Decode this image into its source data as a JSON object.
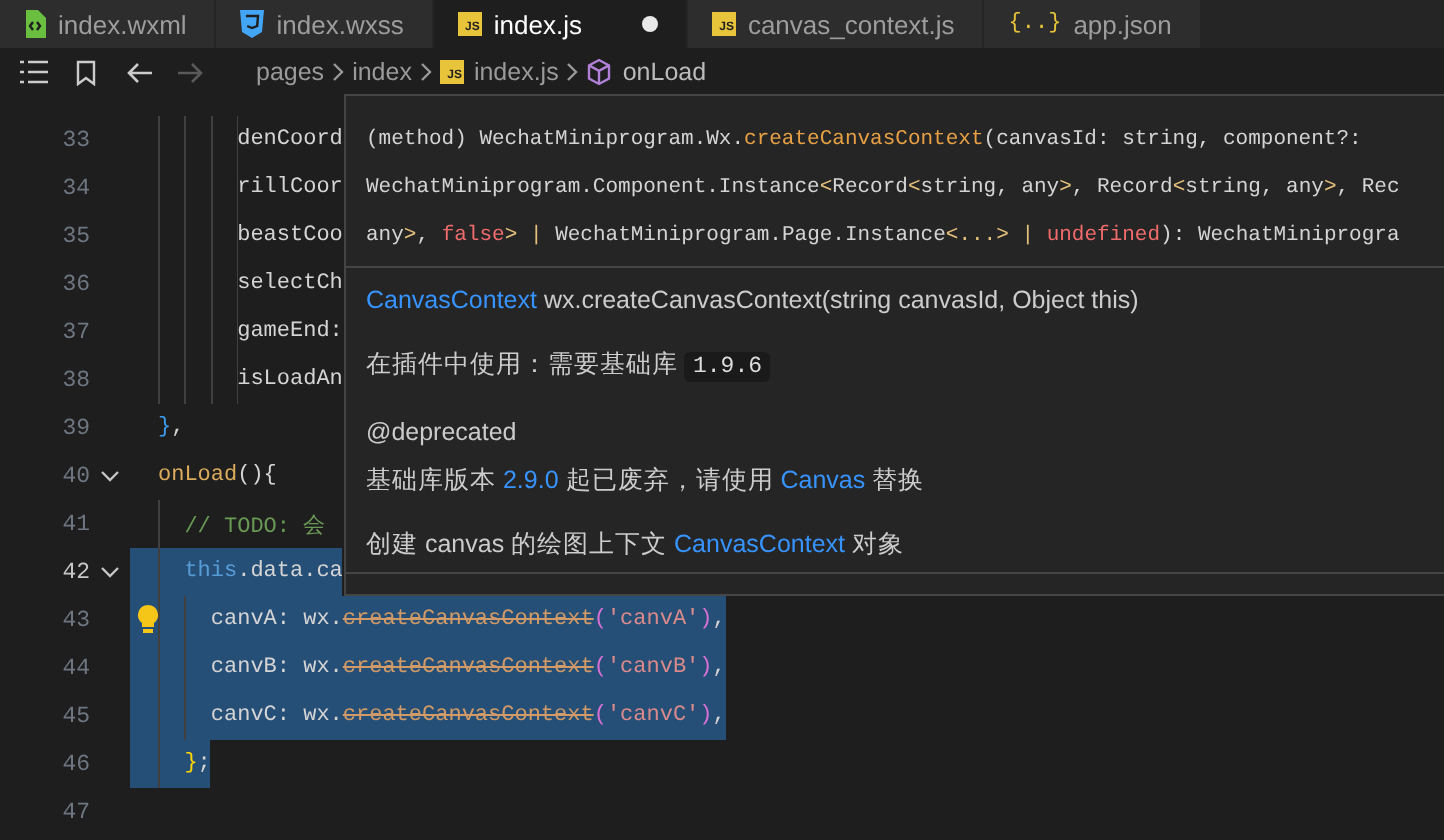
{
  "tabs": [
    {
      "label": "index.wxml",
      "kind": "wxml",
      "selected": false,
      "modified": false
    },
    {
      "label": "index.wxss",
      "kind": "wxss",
      "selected": false,
      "modified": false
    },
    {
      "label": "index.js",
      "kind": "js",
      "icon_label": "JS",
      "selected": true,
      "modified": true
    },
    {
      "label": "canvas_context.js",
      "kind": "js",
      "icon_label": "JS",
      "selected": false,
      "modified": false
    },
    {
      "label": "app.json",
      "kind": "json",
      "icon_label": "{..}",
      "selected": false,
      "modified": false
    }
  ],
  "breadcrumb": [
    {
      "label": "pages",
      "kind": "folder"
    },
    {
      "label": "index",
      "kind": "folder"
    },
    {
      "label": "index.js",
      "kind": "js",
      "icon_label": "JS"
    },
    {
      "label": "onLoad",
      "kind": "method"
    }
  ],
  "code_lines": [
    {
      "number": "33",
      "fold": false,
      "current": false,
      "selected": false,
      "bulb": false,
      "segments": [
        {
          "kind": "prop",
          "t": "      denCoord"
        }
      ]
    },
    {
      "number": "34",
      "fold": false,
      "current": false,
      "selected": false,
      "bulb": false,
      "segments": [
        {
          "kind": "prop",
          "t": "      rillCoor"
        }
      ]
    },
    {
      "number": "35",
      "fold": false,
      "current": false,
      "selected": false,
      "bulb": false,
      "segments": [
        {
          "kind": "prop",
          "t": "      beastCoo"
        }
      ]
    },
    {
      "number": "36",
      "fold": false,
      "current": false,
      "selected": false,
      "bulb": false,
      "segments": [
        {
          "kind": "prop",
          "t": "      selectCh"
        }
      ]
    },
    {
      "number": "37",
      "fold": false,
      "current": false,
      "selected": false,
      "bulb": false,
      "segments": [
        {
          "kind": "prop",
          "t": "      gameEnd:"
        }
      ]
    },
    {
      "number": "38",
      "fold": false,
      "current": false,
      "selected": false,
      "bulb": false,
      "segments": [
        {
          "kind": "prop",
          "t": "      isLoadAn"
        }
      ]
    },
    {
      "number": "39",
      "fold": false,
      "current": false,
      "selected": false,
      "bulb": false,
      "segments": [
        {
          "kind": "brace_blue",
          "t": "}"
        },
        {
          "kind": "plain",
          "t": ","
        }
      ]
    },
    {
      "number": "40",
      "fold": true,
      "current": false,
      "selected": false,
      "bulb": false,
      "segments": [
        {
          "kind": "method",
          "t": "onLoad"
        },
        {
          "kind": "plain",
          "t": "(){"
        }
      ]
    },
    {
      "number": "41",
      "fold": false,
      "current": false,
      "selected": false,
      "bulb": false,
      "segments": [
        {
          "kind": "comment",
          "t": "  // TODO: 会"
        }
      ]
    },
    {
      "number": "42",
      "fold": true,
      "current": true,
      "selected": true,
      "bulb": false,
      "segments": [
        {
          "kind": "keyword",
          "t": "  this"
        },
        {
          "kind": "plain",
          "t": ".data.ca"
        }
      ]
    },
    {
      "number": "43",
      "fold": false,
      "current": false,
      "selected": true,
      "bulb": true,
      "segments": [
        {
          "kind": "plain",
          "t": "    canvA: wx."
        },
        {
          "kind": "deprecated",
          "t": "createCanvasContext"
        },
        {
          "kind": "paren",
          "t": "("
        },
        {
          "kind": "string",
          "t": "'canvA'"
        },
        {
          "kind": "paren",
          "t": ")"
        },
        {
          "kind": "plain",
          "t": ","
        }
      ]
    },
    {
      "number": "44",
      "fold": false,
      "current": false,
      "selected": true,
      "bulb": false,
      "segments": [
        {
          "kind": "plain",
          "t": "    canvB: wx."
        },
        {
          "kind": "deprecated",
          "t": "createCanvasContext"
        },
        {
          "kind": "paren",
          "t": "("
        },
        {
          "kind": "string",
          "t": "'canvB'"
        },
        {
          "kind": "paren",
          "t": ")"
        },
        {
          "kind": "plain",
          "t": ","
        }
      ]
    },
    {
      "number": "45",
      "fold": false,
      "current": false,
      "selected": true,
      "bulb": false,
      "segments": [
        {
          "kind": "plain",
          "t": "    canvC: wx."
        },
        {
          "kind": "deprecated",
          "t": "createCanvasContext"
        },
        {
          "kind": "paren",
          "t": "("
        },
        {
          "kind": "string",
          "t": "'canvC'"
        },
        {
          "kind": "paren",
          "t": ")"
        },
        {
          "kind": "plain",
          "t": ","
        }
      ]
    },
    {
      "number": "46",
      "fold": false,
      "current": false,
      "selected": true,
      "bulb": false,
      "segments": [
        {
          "kind": "brace_yellow",
          "t": "  }"
        },
        {
          "kind": "plain",
          "t": ";"
        }
      ]
    },
    {
      "number": "47",
      "fold": false,
      "current": false,
      "selected": false,
      "bulb": false
    }
  ],
  "hover": {
    "signature": [
      [
        {
          "kind": "text",
          "t": "(method) WechatMiniprogram.Wx."
        },
        {
          "kind": "func",
          "t": "createCanvasContext"
        },
        {
          "kind": "text",
          "t": "(canvasId: string, component?:"
        }
      ],
      [
        {
          "kind": "text",
          "t": "WechatMiniprogram.Component.Instance"
        },
        {
          "kind": "bracket",
          "t": "<"
        },
        {
          "kind": "text",
          "t": "Record"
        },
        {
          "kind": "bracket",
          "t": "<"
        },
        {
          "kind": "text",
          "t": "string, any"
        },
        {
          "kind": "bracket",
          "t": ">"
        },
        {
          "kind": "text",
          "t": ", Record"
        },
        {
          "kind": "bracket",
          "t": "<"
        },
        {
          "kind": "text",
          "t": "string, any"
        },
        {
          "kind": "bracket",
          "t": ">"
        },
        {
          "kind": "text",
          "t": ", Rec"
        }
      ],
      [
        {
          "kind": "text",
          "t": "any"
        },
        {
          "kind": "bracket",
          "t": ">"
        },
        {
          "kind": "text",
          "t": ", "
        },
        {
          "kind": "keyword",
          "t": "false"
        },
        {
          "kind": "bracket",
          "t": "> | "
        },
        {
          "kind": "text",
          "t": "WechatMiniprogram.Page.Instance"
        },
        {
          "kind": "bracket",
          "t": "<...> | "
        },
        {
          "kind": "keyword",
          "t": "undefined"
        },
        {
          "kind": "text",
          "t": "): WechatMiniprogra"
        }
      ]
    ],
    "sections": [
      {
        "paragraphs": [
          [
            {
              "kind": "link",
              "t": "CanvasContext"
            },
            {
              "kind": "text",
              "t": " wx.createCanvasContext(string canvasId, Object this)"
            }
          ]
        ]
      },
      {
        "paragraphs": [
          [
            {
              "kind": "text",
              "t": "在插件中使用：需要基础库 "
            },
            {
              "kind": "code",
              "t": "1.9.6"
            }
          ]
        ]
      },
      {
        "paragraphs": [
          [
            {
              "kind": "text",
              "t": "@deprecated"
            }
          ],
          [
            {
              "kind": "text",
              "t": "基础库版本 "
            },
            {
              "kind": "link",
              "t": "2.9.0"
            },
            {
              "kind": "text",
              "t": " 起已废弃，请使用 "
            },
            {
              "kind": "link",
              "t": "Canvas"
            },
            {
              "kind": "text",
              "t": " 替换"
            }
          ]
        ]
      },
      {
        "paragraphs": [
          [
            {
              "kind": "text",
              "t": "创建 canvas 的绘图上下文 "
            },
            {
              "kind": "link",
              "t": "CanvasContext"
            },
            {
              "kind": "text",
              "t": " 对象"
            }
          ]
        ]
      }
    ]
  }
}
